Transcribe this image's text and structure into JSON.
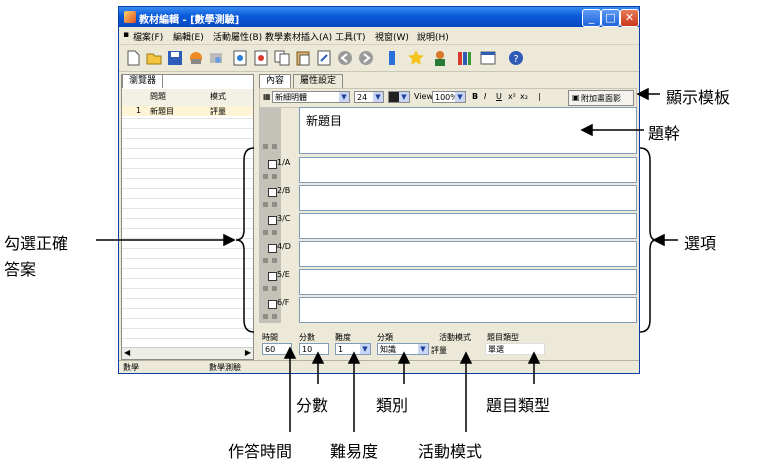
{
  "window": {
    "title": "教材編輯 - [數學測驗]",
    "menu": [
      "檔案(F)",
      "編輯(E)",
      "活動屬性(B)",
      "教學素材插入(A)",
      "工具(T)",
      "視窗(W)",
      "說明(H)"
    ],
    "toolbar_icons": [
      "new-file-icon",
      "open-folder-icon",
      "save-icon",
      "print-icon",
      "preview-icon",
      "insert-page-icon",
      "delete-page-icon",
      "copy-page-icon",
      "paste-page-icon",
      "edit-page-icon",
      "back-icon",
      "forward-icon",
      "settings-icon",
      "favorite-icon",
      "user-icon",
      "book-icon",
      "window-icon",
      "help-icon"
    ]
  },
  "left_panel": {
    "tab": "瀏覽器",
    "columns": [
      "問題",
      "模式"
    ],
    "rows": [
      {
        "index": "1",
        "question": "新題目",
        "mode": "評量"
      }
    ]
  },
  "editor": {
    "tabs": [
      "內容",
      "屬性設定"
    ],
    "toolbar": {
      "template_button": "新細明體",
      "font_size": "24",
      "view_label": "View",
      "zoom": "100%",
      "attach_button": "附加畫面影"
    },
    "stem_text": "新題目",
    "options": [
      "1/A",
      "2/B",
      "3/C",
      "4/D",
      "5/E",
      "6/F"
    ],
    "fields": {
      "time": {
        "label": "時間",
        "value": "60"
      },
      "score": {
        "label": "分數",
        "value": "10"
      },
      "difficulty": {
        "label": "難度",
        "value": "1"
      },
      "category": {
        "label": "分類",
        "value": "知識"
      },
      "activity": {
        "label": "活動模式",
        "value": "評量"
      },
      "qtype": {
        "label": "題目類型",
        "value": "單選"
      }
    }
  },
  "status": {
    "left": "數學",
    "right": "數學測驗"
  },
  "annotations": {
    "template": "顯示模板",
    "stem": "題幹",
    "options": "選項",
    "check_answer_1": "勾選正確",
    "check_answer_2": "答案",
    "score": "分數",
    "category": "類別",
    "qtype": "題目類型",
    "time": "作答時間",
    "difficulty": "難易度",
    "activity": "活動模式"
  },
  "colors": {
    "titlebar": "#0a5ad8",
    "frame": "#ece9d8",
    "border": "#7f9db9"
  }
}
